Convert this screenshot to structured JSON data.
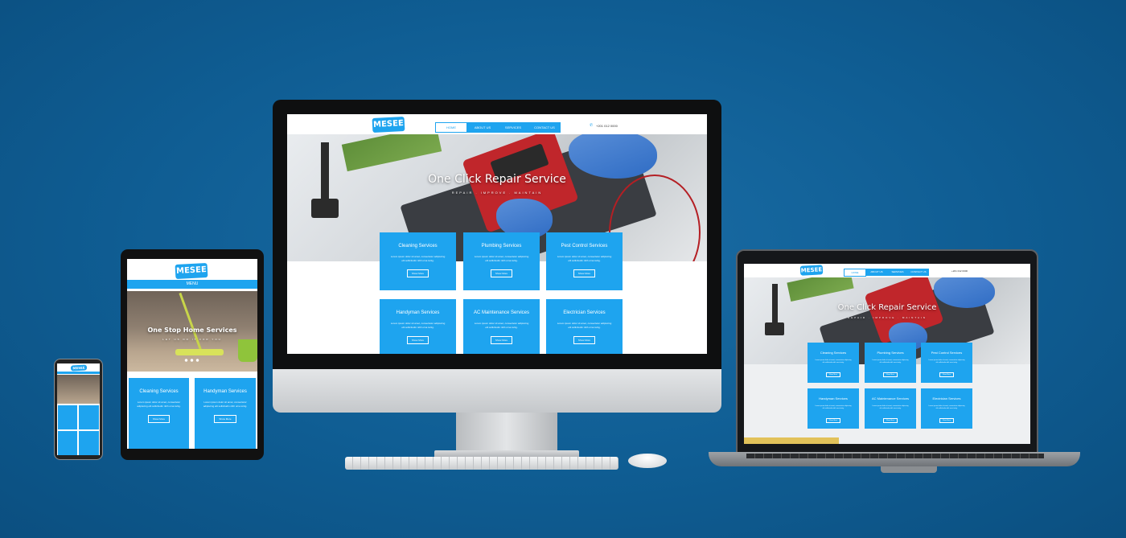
{
  "brand": {
    "logo_text": "MESEE",
    "accent": "#1ea4ef",
    "background": "#0f5d93"
  },
  "nav": {
    "home": "HOME",
    "about": "ABOUT US",
    "services": "SERVICES",
    "contact": "CONTACT US",
    "phone": "+201 012 0000"
  },
  "hero": {
    "title": "One Click Repair Service",
    "subtitle": "REPAIR . IMPROVE . MAINTAIN"
  },
  "services": [
    {
      "title": "Cleaning Services",
      "desc": "Lorem ipsum dolor sit amet, consectetur adipiscing elit sollicitudin nibh urna tortig.",
      "button": "Show More"
    },
    {
      "title": "Plumbing Services",
      "desc": "Lorem ipsum dolor sit amet, consectetur adipiscing elit sollicitudin nibh urna tortig.",
      "button": "Show More"
    },
    {
      "title": "Pest Control Services",
      "desc": "Lorem ipsum dolor sit amet, consectetur adipiscing elit sollicitudin nibh urna tortig.",
      "button": "Show More"
    },
    {
      "title": "Handyman Services",
      "desc": "Lorem ipsum dolor sit amet, consectetur adipiscing elit sollicitudin nibh urna tortig.",
      "button": "Show More"
    },
    {
      "title": "AC Maintenance Services",
      "desc": "Lorem ipsum dolor sit amet, consectetur adipiscing elit sollicitudin nibh urna tortig.",
      "button": "Show More"
    },
    {
      "title": "Electrician Services",
      "desc": "Lorem ipsum dolor sit amet, consectetur adipiscing elit sollicitudin nibh urna tortig.",
      "button": "Show More"
    }
  ],
  "tablet": {
    "menu_label": "MENU",
    "hero_title": "One Stop Home Services",
    "hero_sub": "LET US DO IT FOR YOU",
    "cards": [
      {
        "title": "Cleaning Services",
        "desc": "Lorem ipsum dolor sit amet, consectetur adipiscing elit sollicitudin nibh urna tortig.",
        "button": "Show More"
      },
      {
        "title": "Handyman Services",
        "desc": "Lorem ipsum dolor sit amet, consectetur adipiscing elit sollicitudin nibh urna tortig.",
        "button": "Show More"
      }
    ]
  }
}
